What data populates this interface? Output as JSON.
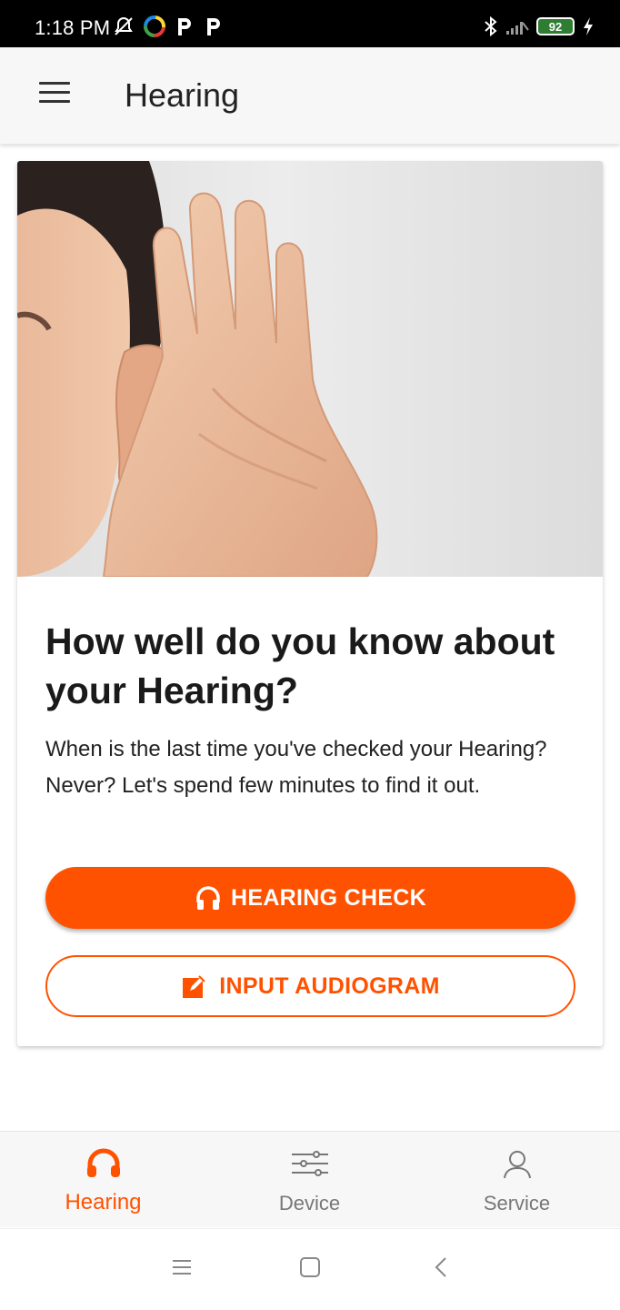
{
  "status_bar": {
    "time": "1:18 PM",
    "battery_level": "92",
    "icons_left": [
      "silent-bell-icon",
      "colorful-app-icon",
      "p-app-icon",
      "p-app-icon"
    ],
    "icons_right": [
      "bluetooth-icon",
      "signal-icon",
      "battery-icon",
      "charging-icon"
    ]
  },
  "app_bar": {
    "title": "Hearing",
    "menu_icon": "hamburger-menu-icon"
  },
  "card": {
    "image": "woman-cupping-ear-photo",
    "title": "How well do you know about your Hearing?",
    "description": "When is the last time you've checked your Hearing? Never? Let's spend few minutes to find it out.",
    "primary_button": {
      "label": "HEARING CHECK",
      "icon": "headphones-icon"
    },
    "secondary_button": {
      "label": "INPUT AUDIOGRAM",
      "icon": "edit-icon"
    }
  },
  "bottom_nav": {
    "items": [
      {
        "label": "Hearing",
        "icon": "headphones-icon",
        "active": true
      },
      {
        "label": "Device",
        "icon": "sliders-icon",
        "active": false
      },
      {
        "label": "Service",
        "icon": "person-icon",
        "active": false
      }
    ]
  },
  "system_nav": [
    "recents-icon",
    "home-icon",
    "back-icon"
  ],
  "colors": {
    "accent": "#ff5200",
    "app_bar_bg": "#f7f7f7",
    "status_bar_bg": "#000000",
    "battery_fill": "#2e7d32"
  }
}
